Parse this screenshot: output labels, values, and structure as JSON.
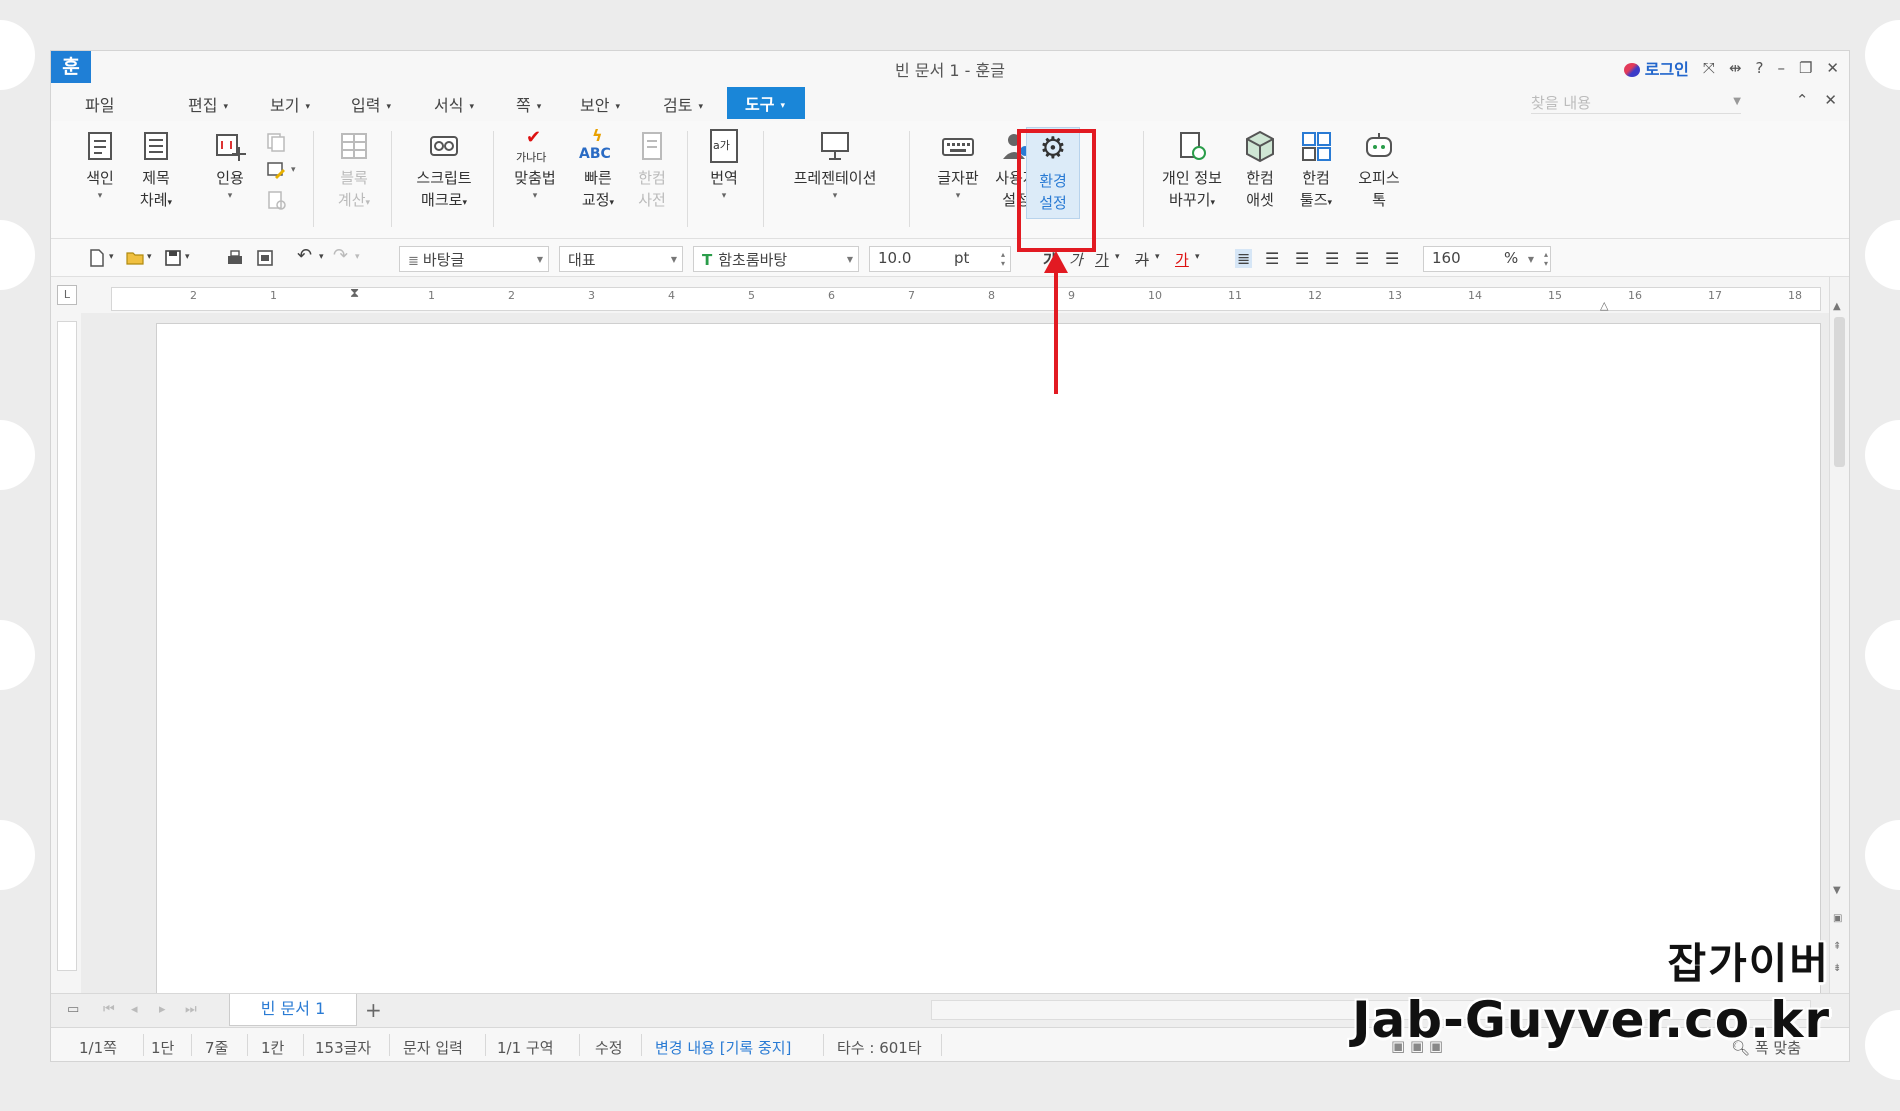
{
  "window": {
    "app_icon": "훈",
    "title": "빈 문서 1 - 훈글",
    "login": "로그인",
    "controls": [
      "⤧",
      "⇹",
      "?",
      "–",
      "❐",
      "✕"
    ]
  },
  "menu": {
    "items": [
      "파일",
      "편집",
      "보기",
      "입력",
      "서식",
      "쪽",
      "보안",
      "검토",
      "도구"
    ],
    "active": "도구",
    "find_placeholder": "찾을 내용",
    "right_controls": [
      "⌃",
      "✕"
    ]
  },
  "ribbon": {
    "index": [
      "색인"
    ],
    "toc": [
      "제목",
      "차례"
    ],
    "citation": [
      "인용"
    ],
    "block_calc": [
      "블록",
      "계산"
    ],
    "script_macro": [
      "스크립트",
      "매크로"
    ],
    "spellcheck": [
      "맞춤법"
    ],
    "autocorrect": [
      "빠른",
      "교정"
    ],
    "hancom_dict": [
      "한컴",
      "사전"
    ],
    "translate": [
      "번역"
    ],
    "presentation": [
      "프레젠테이션"
    ],
    "keyboard": [
      "글자판"
    ],
    "user_settings": [
      "사용자",
      "설정"
    ],
    "preferences": [
      "환경",
      "설정"
    ],
    "privacy": [
      "개인 정보",
      "바꾸기"
    ],
    "hancom_asset": [
      "한컴",
      "애셋"
    ],
    "hancom_tools": [
      "한컴",
      "툴즈"
    ],
    "office_talk": [
      "오피스",
      "톡"
    ],
    "spell_icon_text": "가나다",
    "abc_icon_text": "ABC",
    "translate_icon_text": "a가"
  },
  "format_bar": {
    "style": "바탕글",
    "language": "대표",
    "font": "함초롬바탕",
    "font_icon": "T",
    "size": "10.0",
    "unit": "pt",
    "text_styles": [
      "가",
      "가",
      "가",
      "가",
      "가"
    ],
    "zoom": "160",
    "zoom_unit": "%"
  },
  "ruler": {
    "corner": "L",
    "numbers": [
      "2",
      "1",
      "1",
      "2",
      "3",
      "4",
      "5",
      "6",
      "7",
      "8",
      "9",
      "10",
      "11",
      "12",
      "13",
      "14",
      "15",
      "16",
      "17",
      "18"
    ]
  },
  "tabs": {
    "document_tab": "빈 문서 1",
    "add": "+"
  },
  "status": {
    "page": "1/1쪽",
    "column": "1단",
    "line": "7줄",
    "col": "1칸",
    "chars": "153글자",
    "mode": "문자 입력",
    "section": "1/1 구역",
    "edit": "수정",
    "track_changes": "변경 내용 [기록 중지]",
    "keystrokes": "타수 : 601타",
    "fit": "폭 맞춤"
  },
  "watermark": {
    "ko": "잡가이버",
    "en": "Jab-Guyver.co.kr"
  },
  "colors": {
    "accent": "#1a86d8",
    "highlight_border": "#e21a22"
  }
}
